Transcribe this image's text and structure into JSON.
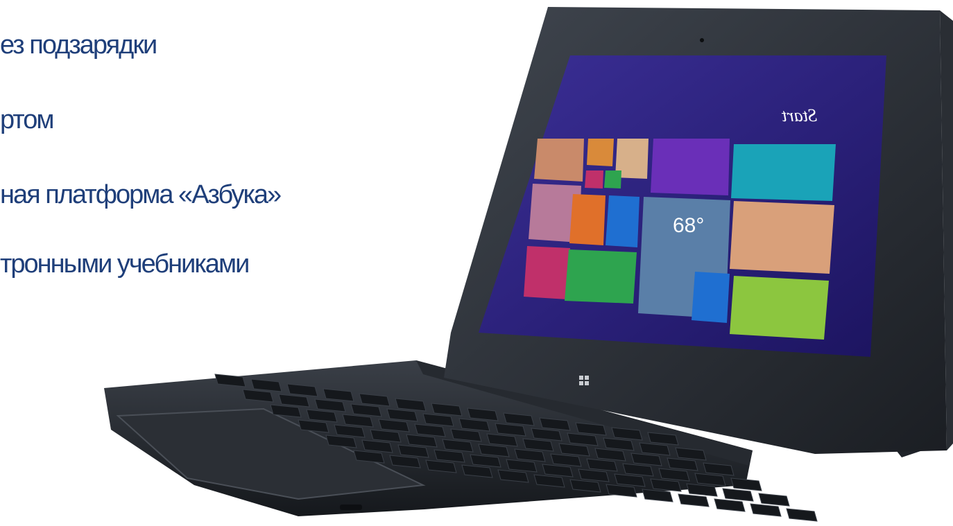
{
  "slide": {
    "bullets": [
      "ез подзарядки",
      "ртом",
      "ная платформа «Азбука»",
      "тронными учебниками"
    ]
  },
  "tablet": {
    "start_label": "Start",
    "weather_temp": "68°",
    "colors": {
      "screen_bg": "#2a1f7a",
      "tile_purple": "#6a2fb8",
      "tile_teal": "#1aa3b8",
      "tile_red": "#d03a3a",
      "tile_green": "#2ea44f",
      "tile_blue": "#1f6fd1",
      "tile_orange": "#e0702a",
      "tile_magenta": "#c0306a",
      "tile_lime": "#8cc63f"
    }
  }
}
